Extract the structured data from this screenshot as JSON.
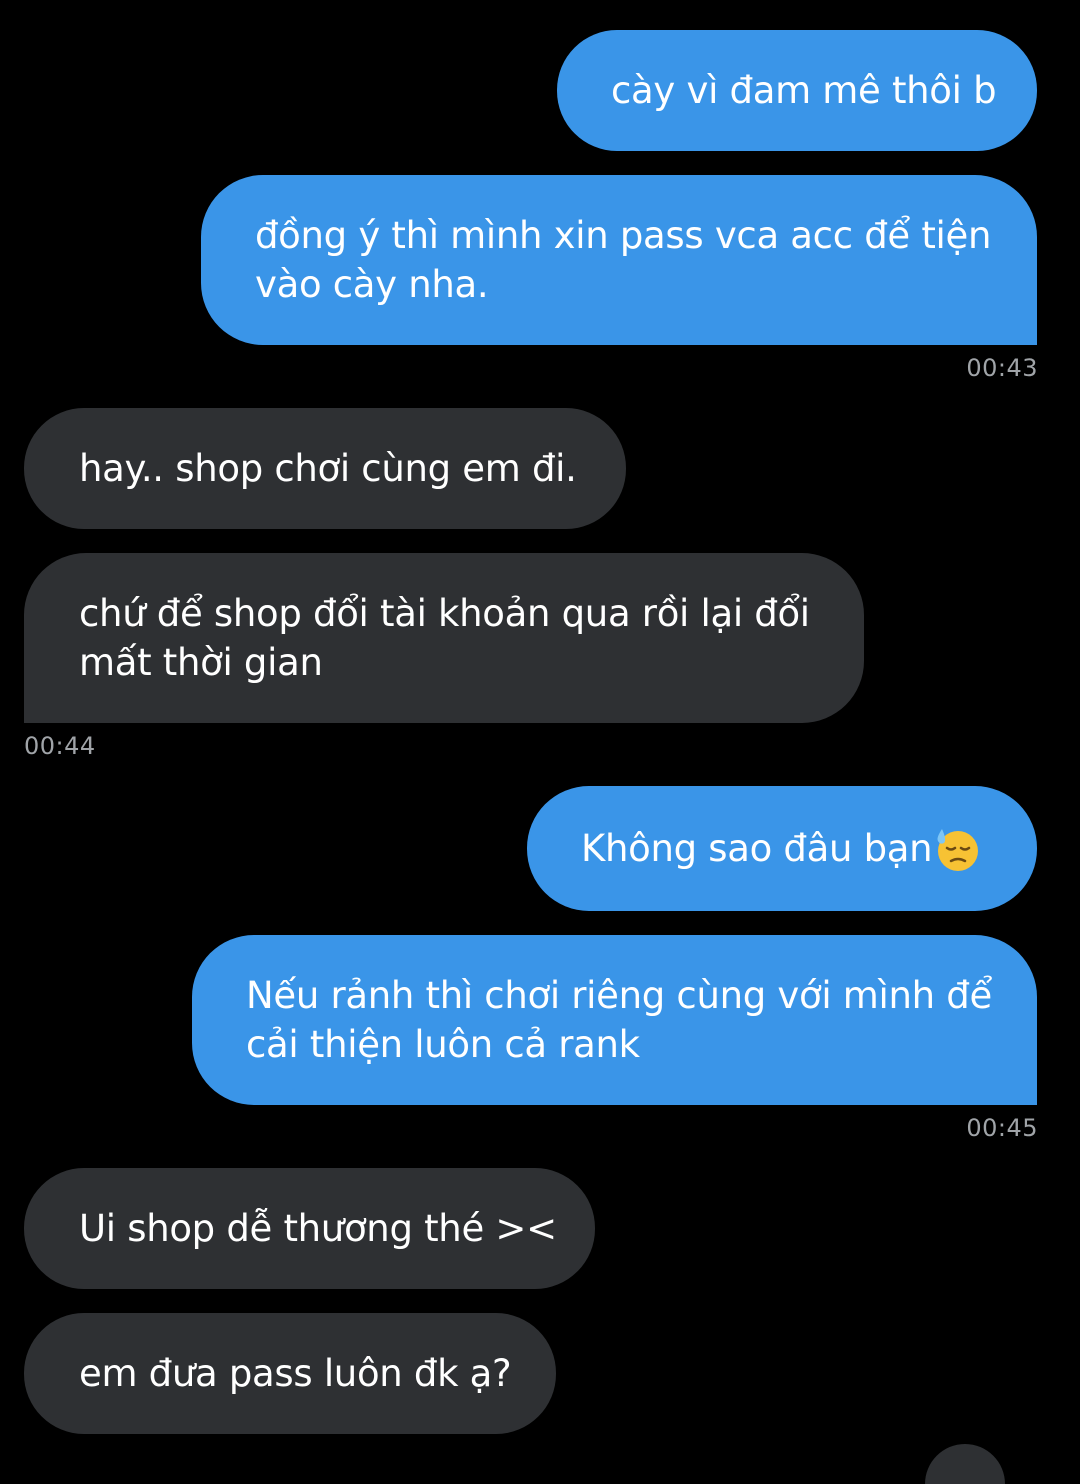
{
  "messages": [
    {
      "direction": "sent",
      "text": "cày vì đam mê thôi b"
    },
    {
      "direction": "sent",
      "lines": [
        "đồng ý thì mình xin pass vca acc để tiện",
        "vào cày nha."
      ],
      "time": "00:43"
    },
    {
      "direction": "received",
      "text": "hay.. shop chơi cùng em đi."
    },
    {
      "direction": "received",
      "lines": [
        "chứ để shop đổi tài khoản qua rồi lại đổi",
        "mất thời gian"
      ],
      "time": "00:44"
    },
    {
      "direction": "sent",
      "text": "Không sao đâu bạn",
      "emoji": "downcast-face-with-sweat-emoji"
    },
    {
      "direction": "sent",
      "lines": [
        "Nếu rảnh thì chơi riêng cùng với mình để",
        "cải thiện luôn cả rank"
      ],
      "time": "00:45"
    },
    {
      "direction": "received",
      "text": "Ui shop dễ thương thé ><"
    },
    {
      "direction": "received",
      "text": "em đưa pass luôn đk ạ?"
    }
  ],
  "colors": {
    "background": "#000000",
    "sent_bubble": "#3a95e8",
    "received_bubble": "#2e3033",
    "timestamp": "#a0a4a8"
  }
}
